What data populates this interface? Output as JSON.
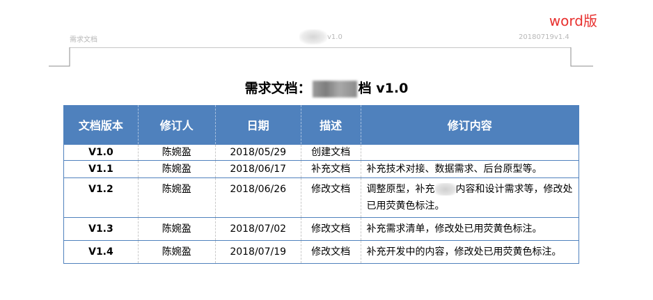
{
  "tag": "word版",
  "page_header": {
    "left": "需求文档",
    "middle": "v1.0",
    "right": "20180719v1.4"
  },
  "title": {
    "prefix": "需求文档：",
    "suffix": "档 v1.0"
  },
  "table": {
    "headers": [
      "文档版本",
      "修订人",
      "日期",
      "描述",
      "修订内容"
    ],
    "rows": [
      {
        "version": "V1.0",
        "author": "陈婉盈",
        "date": "2018/05/29",
        "desc": "创建文档",
        "content": ""
      },
      {
        "version": "V1.1",
        "author": "陈婉盈",
        "date": "2018/06/17",
        "desc": "补充文档",
        "content": "补充技术对接、数据需求、后台原型等。"
      },
      {
        "version": "V1.2",
        "author": "陈婉盈",
        "date": "2018/06/26",
        "desc": "修改文档",
        "content_a": "调整原型，补充",
        "content_b": "内容和设计需求等，修改处已用荧黄色标注。"
      },
      {
        "version": "V1.3",
        "author": "陈婉盈",
        "date": "2018/07/02",
        "desc": "修改文档",
        "content": "补充需求清单，修改处已用荧黄色标注。"
      },
      {
        "version": "V1.4",
        "author": "陈婉盈",
        "date": "2018/07/19",
        "desc": "修改文档",
        "content": "补充开发中的内容，修改处已用荧黄色标注。"
      }
    ]
  }
}
